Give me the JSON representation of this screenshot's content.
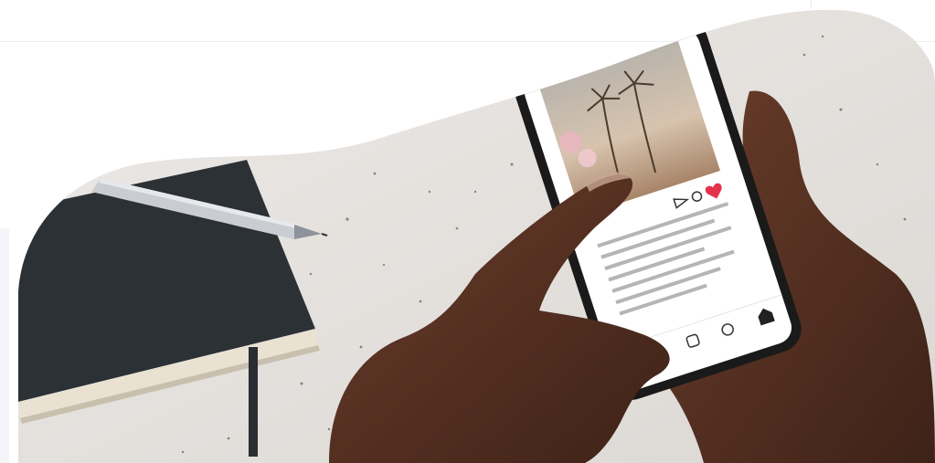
{
  "hero": {
    "alt": "",
    "colors": {
      "counter": "#e9e5e1",
      "speckle": "#3d3530",
      "notebook": "#2c3136",
      "pages": "#e9e1d2",
      "skin": "#5a3424",
      "skin_dark": "#3e2218",
      "phone": "#1a1a1a",
      "screen": "#ffffff",
      "heart": "#e2334b"
    }
  }
}
